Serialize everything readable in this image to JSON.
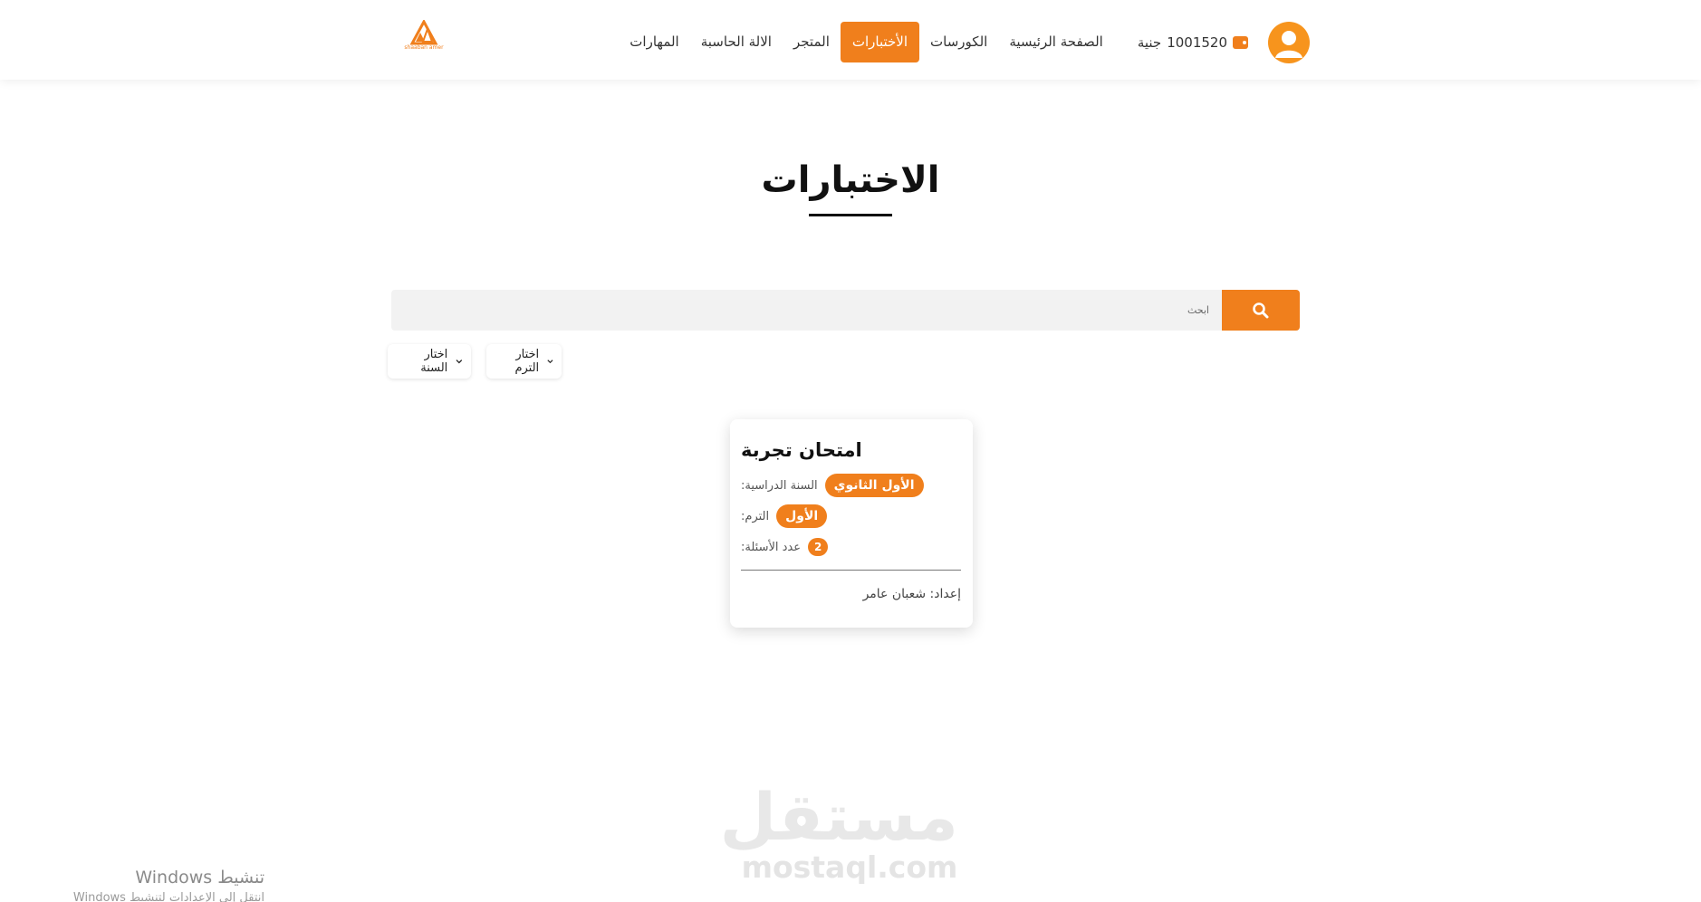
{
  "header": {
    "logo_text": "shaaban amer",
    "wallet": {
      "amount": "1001520",
      "currency": "جنية"
    },
    "nav": [
      {
        "label": "الصفحة الرئيسية",
        "active": false
      },
      {
        "label": "الكورسات",
        "active": false
      },
      {
        "label": "الأختبارات",
        "active": true
      },
      {
        "label": "المتجر",
        "active": false
      },
      {
        "label": "الالة الحاسبة",
        "active": false
      },
      {
        "label": "المهارات",
        "active": false
      }
    ]
  },
  "page": {
    "title": "الاختبارات"
  },
  "search": {
    "placeholder": "ابحث"
  },
  "filters": {
    "term": "اختار الترم",
    "year": "اختار السنة"
  },
  "card": {
    "title": "امتحان تجربة",
    "year_label": ":السنة الدراسية",
    "year_value": "الأول الثانوي",
    "term_label": ":الترم",
    "term_value": "الأول",
    "questions_label": ":عدد الأسئلة",
    "questions_value": "2",
    "author": "إعداد: شعبان عامر"
  },
  "watermark": {
    "arabic": "مستقل",
    "latin": "mostaql.com"
  },
  "windows_notice": {
    "title": "تنشيط Windows",
    "subtitle": "انتقل إلى الإعدادات لتنشيط Windows"
  },
  "colors": {
    "accent": "#f07f1c",
    "avatar": "#f7941d"
  },
  "icons": {
    "search": "search-icon",
    "wallet": "wallet-icon",
    "avatar": "user-icon"
  }
}
